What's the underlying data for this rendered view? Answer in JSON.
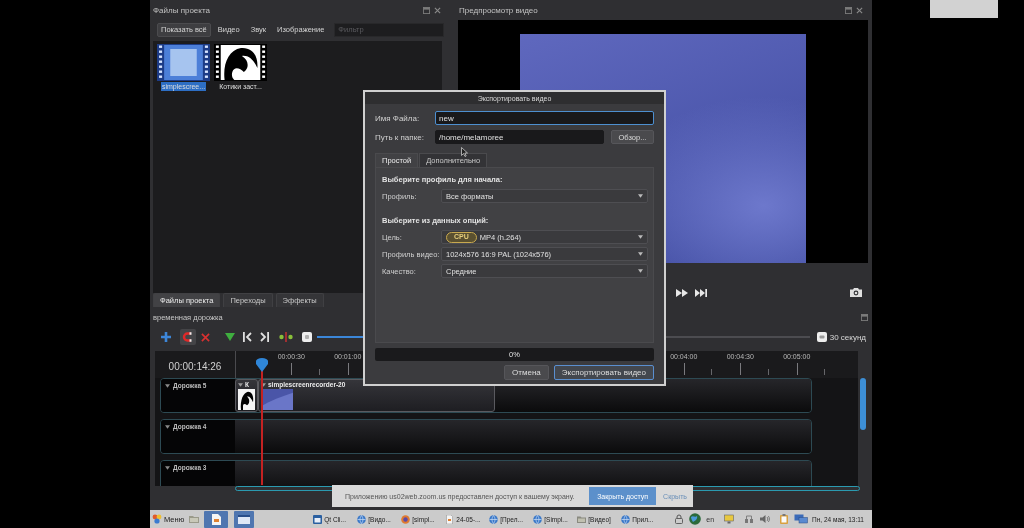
{
  "project_files": {
    "title": "Файлы проекта",
    "filters": [
      {
        "label": "Показать всё",
        "selected": true
      },
      {
        "label": "Видео",
        "selected": false
      },
      {
        "label": "Звук",
        "selected": false
      },
      {
        "label": "Изображение",
        "selected": false
      }
    ],
    "filter_placeholder": "Фильтр",
    "files": [
      {
        "name": "simplescree...",
        "kind": "video",
        "selected": true
      },
      {
        "name": "Котики заст...",
        "kind": "image",
        "selected": false
      }
    ]
  },
  "preview": {
    "title": "Предпросмотр видео"
  },
  "dock_tabs": [
    {
      "label": "Файлы проекта",
      "selected": true
    },
    {
      "label": "Переходы",
      "selected": false
    },
    {
      "label": "Эффекты",
      "selected": false
    }
  ],
  "timeline": {
    "title": "временная дорожка",
    "snap_on": true,
    "zoom": {
      "level": 0.2,
      "label": "30 секунд"
    },
    "timecode": "00:00:14:26",
    "ruler_start": [
      "00:00:30",
      "00:01:00"
    ],
    "ruler_end": [
      "00:04:00",
      "00:04:30",
      "00:05:00"
    ],
    "tracks": [
      {
        "name": "Дорожка 5",
        "clips": [
          {
            "kind": "image",
            "title": "К"
          },
          {
            "kind": "video",
            "title": "simplescreenrecorder-20"
          }
        ]
      },
      {
        "name": "Дорожка 4"
      },
      {
        "name": "Дорожка 3"
      }
    ]
  },
  "export_dialog": {
    "title": "Экспортировать видео",
    "fields": [
      {
        "label": "Имя Файла:",
        "value": "new",
        "focused": true
      },
      {
        "label": "Путь к папке:",
        "value": "/home/melamoree",
        "focused": false,
        "button": "Обзор..."
      }
    ],
    "tabs": [
      {
        "label": "Простой",
        "selected": true
      },
      {
        "label": "Дополнительно",
        "selected": false
      }
    ],
    "sections": [
      {
        "heading": "Выберите профиль для начала:",
        "rows": [
          {
            "label": "Профиль:",
            "value": "Все форматы"
          }
        ]
      },
      {
        "heading": "Выберите из данных опций:",
        "rows": [
          {
            "label": "Цель:",
            "badge": "CPU",
            "value": "MP4 (h.264)"
          },
          {
            "label": "Профиль видео:",
            "value": "1024x576 16:9 PAL (1024x576)"
          },
          {
            "label": "Качество:",
            "value": "Средние"
          }
        ]
      }
    ],
    "progress": {
      "level": 0,
      "text": "0%"
    },
    "buttons": [
      {
        "label": "Отмена",
        "kind": "plain"
      },
      {
        "label": "Экспортировать видео",
        "kind": "default"
      }
    ]
  },
  "notification": {
    "text": "Приложению us02web.zoom.us предоставлен доступ к вашему экрану.",
    "button": "Закрыть доступ",
    "link": "Скрыть"
  },
  "taskbar": {
    "menu": "Меню",
    "tasks": [
      {
        "label": "Qt Cli..."
      },
      {
        "label": "[Видо..."
      },
      {
        "label": "[simpl..."
      },
      {
        "label": "24-05-..."
      },
      {
        "label": "[Прел..."
      },
      {
        "label": "[Simpl..."
      },
      {
        "label": "[Видео]"
      },
      {
        "label": "Прил..."
      }
    ],
    "language": "en",
    "clock": "Пн, 24 мая, 13:11"
  }
}
